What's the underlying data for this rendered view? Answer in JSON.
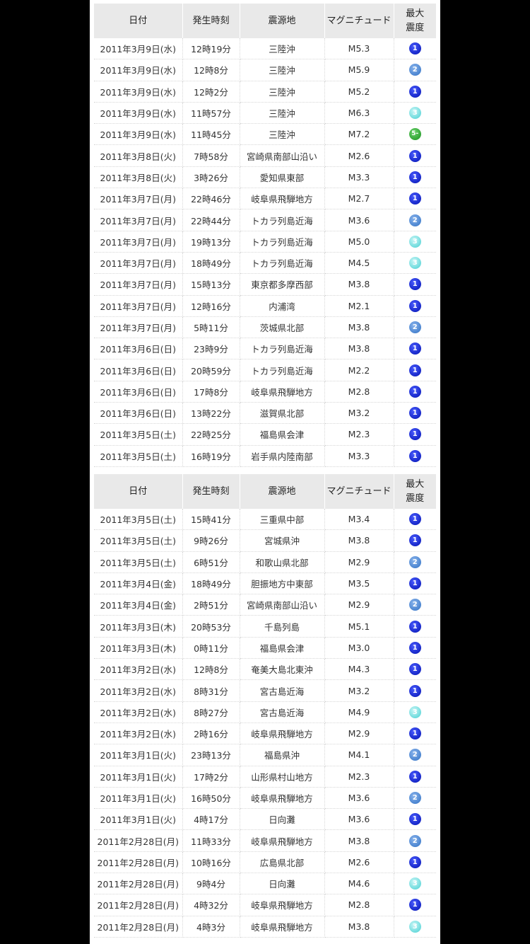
{
  "headers": {
    "date": "日付",
    "time": "発生時刻",
    "epicenter": "震源地",
    "magnitude": "マグニチュード",
    "intensity_line1": "最大",
    "intensity_line2": "震度"
  },
  "intensity_colors": {
    "1": "#0a18c8",
    "2": "#3f7fd0",
    "3": "#5ad6d8",
    "5-": "#27a42b"
  },
  "tables": [
    {
      "rows": [
        {
          "date": "2011年3月9日(水)",
          "time": "12時19分",
          "epicenter": "三陸沖",
          "magnitude": "M5.3",
          "intensity": "1"
        },
        {
          "date": "2011年3月9日(水)",
          "time": "12時8分",
          "epicenter": "三陸沖",
          "magnitude": "M5.9",
          "intensity": "2"
        },
        {
          "date": "2011年3月9日(水)",
          "time": "12時2分",
          "epicenter": "三陸沖",
          "magnitude": "M5.2",
          "intensity": "1"
        },
        {
          "date": "2011年3月9日(水)",
          "time": "11時57分",
          "epicenter": "三陸沖",
          "magnitude": "M6.3",
          "intensity": "3"
        },
        {
          "date": "2011年3月9日(水)",
          "time": "11時45分",
          "epicenter": "三陸沖",
          "magnitude": "M7.2",
          "intensity": "5-"
        },
        {
          "date": "2011年3月8日(火)",
          "time": "7時58分",
          "epicenter": "宮崎県南部山沿い",
          "magnitude": "M2.6",
          "intensity": "1"
        },
        {
          "date": "2011年3月8日(火)",
          "time": "3時26分",
          "epicenter": "愛知県東部",
          "magnitude": "M3.3",
          "intensity": "1"
        },
        {
          "date": "2011年3月7日(月)",
          "time": "22時46分",
          "epicenter": "岐阜県飛騨地方",
          "magnitude": "M2.7",
          "intensity": "1"
        },
        {
          "date": "2011年3月7日(月)",
          "time": "22時44分",
          "epicenter": "トカラ列島近海",
          "magnitude": "M3.6",
          "intensity": "2"
        },
        {
          "date": "2011年3月7日(月)",
          "time": "19時13分",
          "epicenter": "トカラ列島近海",
          "magnitude": "M5.0",
          "intensity": "3"
        },
        {
          "date": "2011年3月7日(月)",
          "time": "18時49分",
          "epicenter": "トカラ列島近海",
          "magnitude": "M4.5",
          "intensity": "3"
        },
        {
          "date": "2011年3月7日(月)",
          "time": "15時13分",
          "epicenter": "東京都多摩西部",
          "magnitude": "M3.8",
          "intensity": "1"
        },
        {
          "date": "2011年3月7日(月)",
          "time": "12時16分",
          "epicenter": "内浦湾",
          "magnitude": "M2.1",
          "intensity": "1"
        },
        {
          "date": "2011年3月7日(月)",
          "time": "5時11分",
          "epicenter": "茨城県北部",
          "magnitude": "M3.8",
          "intensity": "2"
        },
        {
          "date": "2011年3月6日(日)",
          "time": "23時9分",
          "epicenter": "トカラ列島近海",
          "magnitude": "M3.8",
          "intensity": "1"
        },
        {
          "date": "2011年3月6日(日)",
          "time": "20時59分",
          "epicenter": "トカラ列島近海",
          "magnitude": "M2.2",
          "intensity": "1"
        },
        {
          "date": "2011年3月6日(日)",
          "time": "17時8分",
          "epicenter": "岐阜県飛騨地方",
          "magnitude": "M2.8",
          "intensity": "1"
        },
        {
          "date": "2011年3月6日(日)",
          "time": "13時22分",
          "epicenter": "滋賀県北部",
          "magnitude": "M3.2",
          "intensity": "1"
        },
        {
          "date": "2011年3月5日(土)",
          "time": "22時25分",
          "epicenter": "福島県会津",
          "magnitude": "M2.3",
          "intensity": "1"
        },
        {
          "date": "2011年3月5日(土)",
          "time": "16時19分",
          "epicenter": "岩手県内陸南部",
          "magnitude": "M3.3",
          "intensity": "1"
        }
      ]
    },
    {
      "rows": [
        {
          "date": "2011年3月5日(土)",
          "time": "15時41分",
          "epicenter": "三重県中部",
          "magnitude": "M3.4",
          "intensity": "1"
        },
        {
          "date": "2011年3月5日(土)",
          "time": "9時26分",
          "epicenter": "宮城県沖",
          "magnitude": "M3.8",
          "intensity": "1"
        },
        {
          "date": "2011年3月5日(土)",
          "time": "6時51分",
          "epicenter": "和歌山県北部",
          "magnitude": "M2.9",
          "intensity": "2"
        },
        {
          "date": "2011年3月4日(金)",
          "time": "18時49分",
          "epicenter": "胆振地方中東部",
          "magnitude": "M3.5",
          "intensity": "1"
        },
        {
          "date": "2011年3月4日(金)",
          "time": "2時51分",
          "epicenter": "宮崎県南部山沿い",
          "magnitude": "M2.9",
          "intensity": "2"
        },
        {
          "date": "2011年3月3日(木)",
          "time": "20時53分",
          "epicenter": "千島列島",
          "magnitude": "M5.1",
          "intensity": "1"
        },
        {
          "date": "2011年3月3日(木)",
          "time": "0時11分",
          "epicenter": "福島県会津",
          "magnitude": "M3.0",
          "intensity": "1"
        },
        {
          "date": "2011年3月2日(水)",
          "time": "12時8分",
          "epicenter": "奄美大島北東沖",
          "magnitude": "M4.3",
          "intensity": "1"
        },
        {
          "date": "2011年3月2日(水)",
          "time": "8時31分",
          "epicenter": "宮古島近海",
          "magnitude": "M3.2",
          "intensity": "1"
        },
        {
          "date": "2011年3月2日(水)",
          "time": "8時27分",
          "epicenter": "宮古島近海",
          "magnitude": "M4.9",
          "intensity": "3"
        },
        {
          "date": "2011年3月2日(水)",
          "time": "2時16分",
          "epicenter": "岐阜県飛騨地方",
          "magnitude": "M2.9",
          "intensity": "1"
        },
        {
          "date": "2011年3月1日(火)",
          "time": "23時13分",
          "epicenter": "福島県沖",
          "magnitude": "M4.1",
          "intensity": "2"
        },
        {
          "date": "2011年3月1日(火)",
          "time": "17時2分",
          "epicenter": "山形県村山地方",
          "magnitude": "M2.3",
          "intensity": "1"
        },
        {
          "date": "2011年3月1日(火)",
          "time": "16時50分",
          "epicenter": "岐阜県飛騨地方",
          "magnitude": "M3.6",
          "intensity": "2"
        },
        {
          "date": "2011年3月1日(火)",
          "time": "4時17分",
          "epicenter": "日向灘",
          "magnitude": "M3.6",
          "intensity": "1"
        },
        {
          "date": "2011年2月28日(月)",
          "time": "11時33分",
          "epicenter": "岐阜県飛騨地方",
          "magnitude": "M3.8",
          "intensity": "2"
        },
        {
          "date": "2011年2月28日(月)",
          "time": "10時16分",
          "epicenter": "広島県北部",
          "magnitude": "M2.6",
          "intensity": "1"
        },
        {
          "date": "2011年2月28日(月)",
          "time": "9時4分",
          "epicenter": "日向灘",
          "magnitude": "M4.6",
          "intensity": "3"
        },
        {
          "date": "2011年2月28日(月)",
          "time": "4時32分",
          "epicenter": "岐阜県飛騨地方",
          "magnitude": "M2.8",
          "intensity": "1"
        },
        {
          "date": "2011年2月28日(月)",
          "time": "4時3分",
          "epicenter": "岐阜県飛騨地方",
          "magnitude": "M3.8",
          "intensity": "3"
        }
      ]
    }
  ]
}
